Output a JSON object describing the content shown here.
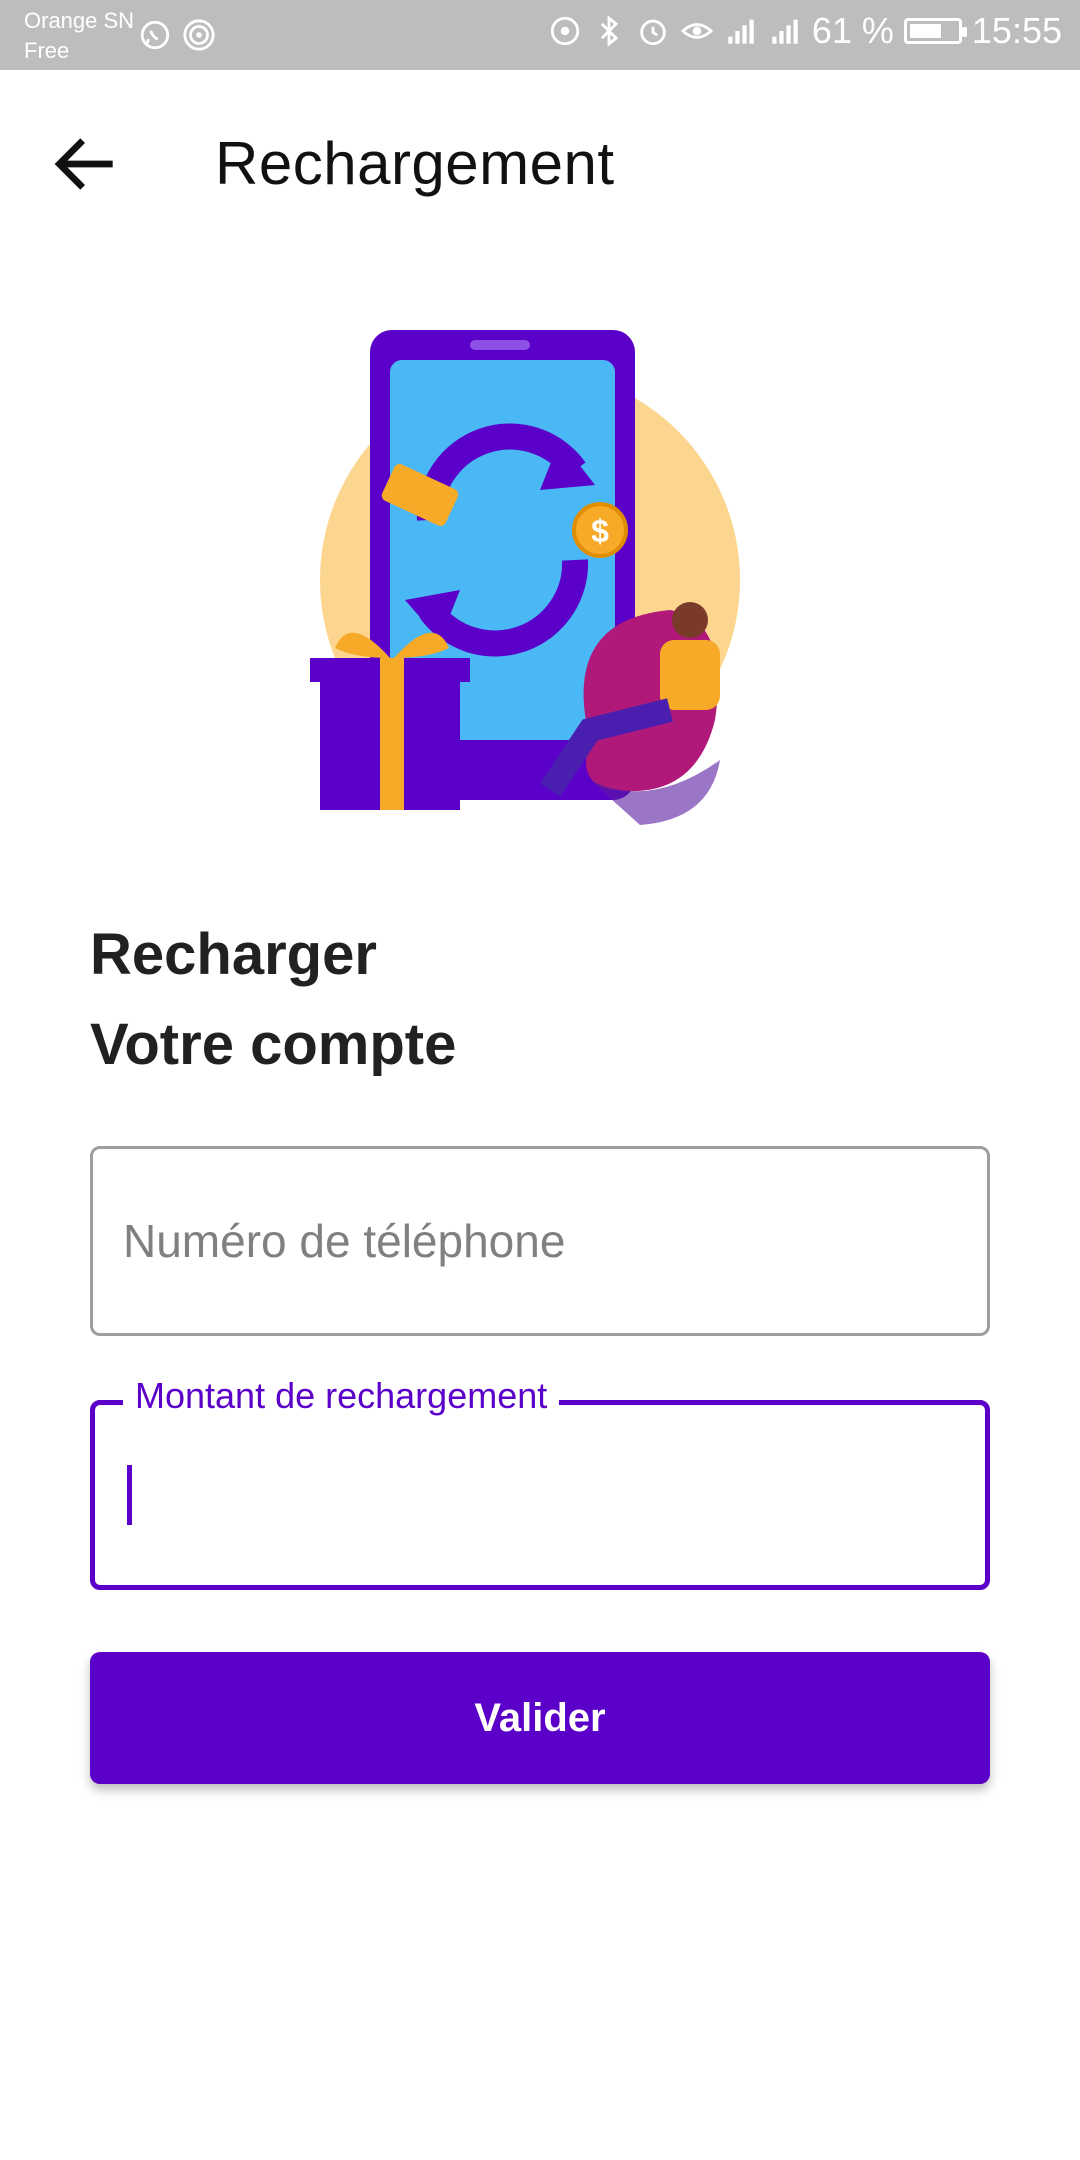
{
  "status_bar": {
    "carrier_line1": "Orange SN",
    "carrier_line2": "Free",
    "battery_percent": "61 %",
    "time": "15:55"
  },
  "header": {
    "title": "Rechargement"
  },
  "main": {
    "heading_line1": "Recharger",
    "heading_line2": "Votre compte",
    "phone_placeholder": "Numéro de téléphone",
    "amount_label": "Montant de rechargement",
    "amount_value": "",
    "submit_label": "Valider"
  },
  "colors": {
    "accent": "#5b00c9",
    "status_bar": "#bdbdbd"
  }
}
